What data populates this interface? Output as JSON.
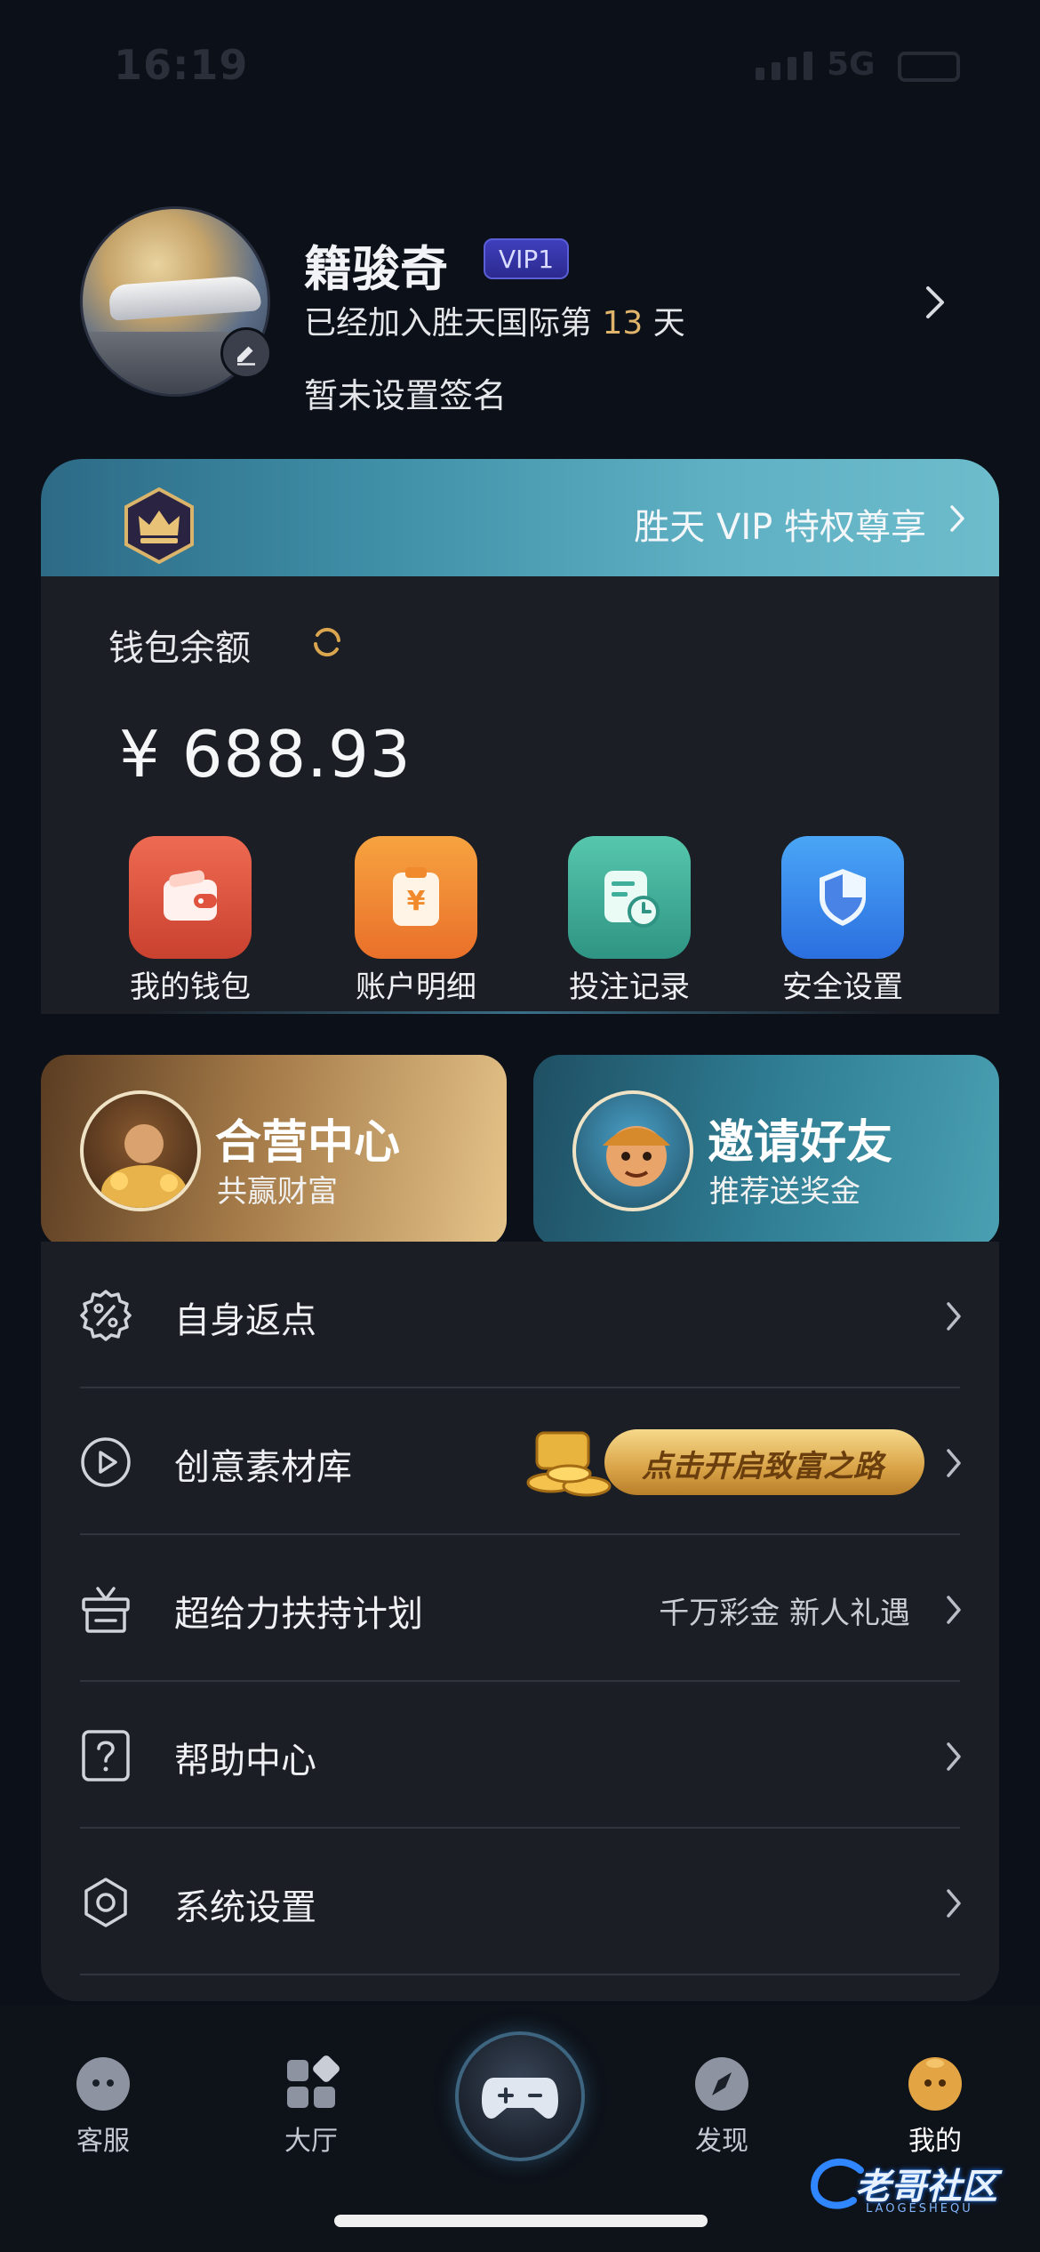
{
  "status_bar": {
    "time": "16:19",
    "network": "5G"
  },
  "profile": {
    "name": "籍骏奇",
    "vip_level": "VIP1",
    "joined_prefix": "已经加入胜天国际第",
    "joined_days": "13",
    "joined_suffix": "天",
    "signature": "暂未设置签名"
  },
  "vip_banner": {
    "text": "胜天 VIP 特权尊享"
  },
  "wallet": {
    "label": "钱包余额",
    "balance": "¥ 688.93",
    "actions": [
      {
        "label": "我的钱包",
        "icon": "wallet-icon",
        "color": "#e0533f"
      },
      {
        "label": "账户明细",
        "icon": "yuan-clipboard-icon",
        "color": "#f08a2c"
      },
      {
        "label": "投注记录",
        "icon": "bet-record-icon",
        "color": "#3fae9a"
      },
      {
        "label": "安全设置",
        "icon": "shield-icon",
        "color": "#3a8ef0"
      }
    ]
  },
  "promos": {
    "partner": {
      "title": "合营中心",
      "subtitle": "共赢财富"
    },
    "invite": {
      "title": "邀请好友",
      "subtitle": "推荐送奖金"
    }
  },
  "menu": [
    {
      "label": "自身返点",
      "icon": "percent-gear-icon",
      "extra": ""
    },
    {
      "label": "创意素材库",
      "icon": "play-circle-icon",
      "extra": "",
      "banner": "点击开启致富之路"
    },
    {
      "label": "超给力扶持计划",
      "icon": "gift-icon",
      "extra": "千万彩金 新人礼遇"
    },
    {
      "label": "帮助中心",
      "icon": "help-icon",
      "extra": ""
    },
    {
      "label": "系统设置",
      "icon": "settings-gear-icon",
      "extra": ""
    }
  ],
  "tabbar": [
    {
      "label": "客服",
      "icon": "support-icon"
    },
    {
      "label": "大厅",
      "icon": "grid-icon"
    },
    {
      "label": "",
      "icon": "gamepad-icon"
    },
    {
      "label": "发现",
      "icon": "compass-icon"
    },
    {
      "label": "我的",
      "icon": "profile-icon",
      "active": true
    }
  ],
  "watermark": {
    "text": "老哥社区",
    "sub": "LAOGESHEQU"
  },
  "colors": {
    "background": "#0c1018",
    "card": "#1b1e25",
    "accent_gold": "#e0b46a",
    "vip_teal": "#4aa0b2"
  }
}
